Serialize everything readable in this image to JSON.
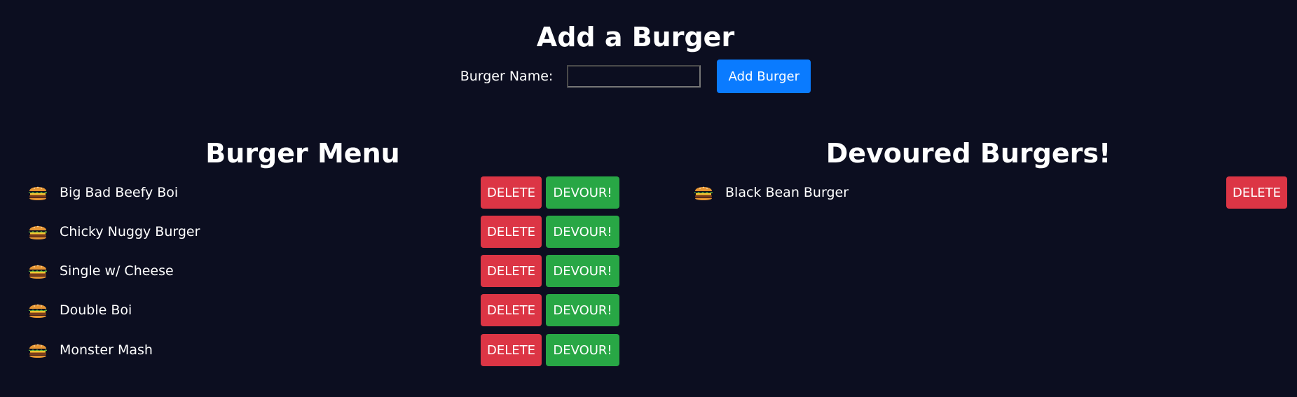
{
  "add_section": {
    "title": "Add a Burger",
    "label": "Burger Name:",
    "input_value": "",
    "button_label": "Add Burger"
  },
  "menu": {
    "title": "Burger Menu",
    "delete_label": "DELETE",
    "devour_label": "DEVOUR!",
    "items": [
      {
        "icon": "burger-icon",
        "name": "Big Bad Beefy Boi"
      },
      {
        "icon": "burger-icon",
        "name": "Chicky Nuggy Burger"
      },
      {
        "icon": "burger-icon",
        "name": "Single w/ Cheese"
      },
      {
        "icon": "burger-icon",
        "name": "Double Boi"
      },
      {
        "icon": "burger-icon",
        "name": "Monster Mash"
      }
    ]
  },
  "devoured": {
    "title": "Devoured Burgers!",
    "delete_label": "DELETE",
    "items": [
      {
        "icon": "burger-icon",
        "name": "Black Bean Burger"
      }
    ]
  },
  "colors": {
    "background": "#0c0e20",
    "primary": "#0a7bff",
    "danger": "#dc3545",
    "success": "#28a745"
  }
}
